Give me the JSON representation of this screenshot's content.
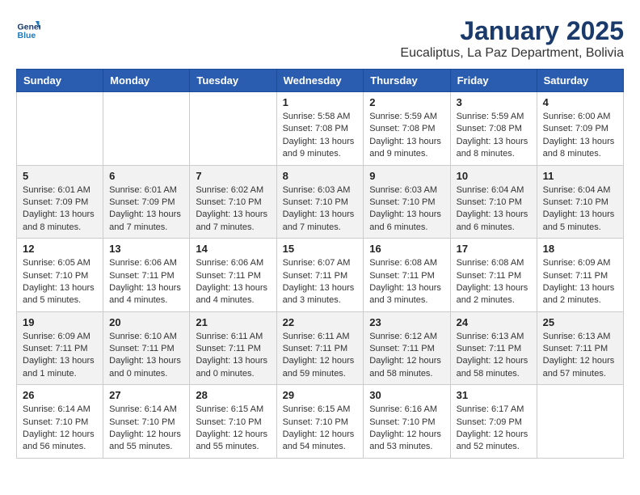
{
  "header": {
    "logo_general": "General",
    "logo_blue": "Blue",
    "month_title": "January 2025",
    "subtitle": "Eucaliptus, La Paz Department, Bolivia"
  },
  "days_of_week": [
    "Sunday",
    "Monday",
    "Tuesday",
    "Wednesday",
    "Thursday",
    "Friday",
    "Saturday"
  ],
  "weeks": [
    [
      {
        "day": "",
        "sunrise": "",
        "sunset": "",
        "daylight": ""
      },
      {
        "day": "",
        "sunrise": "",
        "sunset": "",
        "daylight": ""
      },
      {
        "day": "",
        "sunrise": "",
        "sunset": "",
        "daylight": ""
      },
      {
        "day": "1",
        "sunrise": "Sunrise: 5:58 AM",
        "sunset": "Sunset: 7:08 PM",
        "daylight": "Daylight: 13 hours and 9 minutes."
      },
      {
        "day": "2",
        "sunrise": "Sunrise: 5:59 AM",
        "sunset": "Sunset: 7:08 PM",
        "daylight": "Daylight: 13 hours and 9 minutes."
      },
      {
        "day": "3",
        "sunrise": "Sunrise: 5:59 AM",
        "sunset": "Sunset: 7:08 PM",
        "daylight": "Daylight: 13 hours and 8 minutes."
      },
      {
        "day": "4",
        "sunrise": "Sunrise: 6:00 AM",
        "sunset": "Sunset: 7:09 PM",
        "daylight": "Daylight: 13 hours and 8 minutes."
      }
    ],
    [
      {
        "day": "5",
        "sunrise": "Sunrise: 6:01 AM",
        "sunset": "Sunset: 7:09 PM",
        "daylight": "Daylight: 13 hours and 8 minutes."
      },
      {
        "day": "6",
        "sunrise": "Sunrise: 6:01 AM",
        "sunset": "Sunset: 7:09 PM",
        "daylight": "Daylight: 13 hours and 7 minutes."
      },
      {
        "day": "7",
        "sunrise": "Sunrise: 6:02 AM",
        "sunset": "Sunset: 7:10 PM",
        "daylight": "Daylight: 13 hours and 7 minutes."
      },
      {
        "day": "8",
        "sunrise": "Sunrise: 6:03 AM",
        "sunset": "Sunset: 7:10 PM",
        "daylight": "Daylight: 13 hours and 7 minutes."
      },
      {
        "day": "9",
        "sunrise": "Sunrise: 6:03 AM",
        "sunset": "Sunset: 7:10 PM",
        "daylight": "Daylight: 13 hours and 6 minutes."
      },
      {
        "day": "10",
        "sunrise": "Sunrise: 6:04 AM",
        "sunset": "Sunset: 7:10 PM",
        "daylight": "Daylight: 13 hours and 6 minutes."
      },
      {
        "day": "11",
        "sunrise": "Sunrise: 6:04 AM",
        "sunset": "Sunset: 7:10 PM",
        "daylight": "Daylight: 13 hours and 5 minutes."
      }
    ],
    [
      {
        "day": "12",
        "sunrise": "Sunrise: 6:05 AM",
        "sunset": "Sunset: 7:10 PM",
        "daylight": "Daylight: 13 hours and 5 minutes."
      },
      {
        "day": "13",
        "sunrise": "Sunrise: 6:06 AM",
        "sunset": "Sunset: 7:11 PM",
        "daylight": "Daylight: 13 hours and 4 minutes."
      },
      {
        "day": "14",
        "sunrise": "Sunrise: 6:06 AM",
        "sunset": "Sunset: 7:11 PM",
        "daylight": "Daylight: 13 hours and 4 minutes."
      },
      {
        "day": "15",
        "sunrise": "Sunrise: 6:07 AM",
        "sunset": "Sunset: 7:11 PM",
        "daylight": "Daylight: 13 hours and 3 minutes."
      },
      {
        "day": "16",
        "sunrise": "Sunrise: 6:08 AM",
        "sunset": "Sunset: 7:11 PM",
        "daylight": "Daylight: 13 hours and 3 minutes."
      },
      {
        "day": "17",
        "sunrise": "Sunrise: 6:08 AM",
        "sunset": "Sunset: 7:11 PM",
        "daylight": "Daylight: 13 hours and 2 minutes."
      },
      {
        "day": "18",
        "sunrise": "Sunrise: 6:09 AM",
        "sunset": "Sunset: 7:11 PM",
        "daylight": "Daylight: 13 hours and 2 minutes."
      }
    ],
    [
      {
        "day": "19",
        "sunrise": "Sunrise: 6:09 AM",
        "sunset": "Sunset: 7:11 PM",
        "daylight": "Daylight: 13 hours and 1 minute."
      },
      {
        "day": "20",
        "sunrise": "Sunrise: 6:10 AM",
        "sunset": "Sunset: 7:11 PM",
        "daylight": "Daylight: 13 hours and 0 minutes."
      },
      {
        "day": "21",
        "sunrise": "Sunrise: 6:11 AM",
        "sunset": "Sunset: 7:11 PM",
        "daylight": "Daylight: 13 hours and 0 minutes."
      },
      {
        "day": "22",
        "sunrise": "Sunrise: 6:11 AM",
        "sunset": "Sunset: 7:11 PM",
        "daylight": "Daylight: 12 hours and 59 minutes."
      },
      {
        "day": "23",
        "sunrise": "Sunrise: 6:12 AM",
        "sunset": "Sunset: 7:11 PM",
        "daylight": "Daylight: 12 hours and 58 minutes."
      },
      {
        "day": "24",
        "sunrise": "Sunrise: 6:13 AM",
        "sunset": "Sunset: 7:11 PM",
        "daylight": "Daylight: 12 hours and 58 minutes."
      },
      {
        "day": "25",
        "sunrise": "Sunrise: 6:13 AM",
        "sunset": "Sunset: 7:11 PM",
        "daylight": "Daylight: 12 hours and 57 minutes."
      }
    ],
    [
      {
        "day": "26",
        "sunrise": "Sunrise: 6:14 AM",
        "sunset": "Sunset: 7:10 PM",
        "daylight": "Daylight: 12 hours and 56 minutes."
      },
      {
        "day": "27",
        "sunrise": "Sunrise: 6:14 AM",
        "sunset": "Sunset: 7:10 PM",
        "daylight": "Daylight: 12 hours and 55 minutes."
      },
      {
        "day": "28",
        "sunrise": "Sunrise: 6:15 AM",
        "sunset": "Sunset: 7:10 PM",
        "daylight": "Daylight: 12 hours and 55 minutes."
      },
      {
        "day": "29",
        "sunrise": "Sunrise: 6:15 AM",
        "sunset": "Sunset: 7:10 PM",
        "daylight": "Daylight: 12 hours and 54 minutes."
      },
      {
        "day": "30",
        "sunrise": "Sunrise: 6:16 AM",
        "sunset": "Sunset: 7:10 PM",
        "daylight": "Daylight: 12 hours and 53 minutes."
      },
      {
        "day": "31",
        "sunrise": "Sunrise: 6:17 AM",
        "sunset": "Sunset: 7:09 PM",
        "daylight": "Daylight: 12 hours and 52 minutes."
      },
      {
        "day": "",
        "sunrise": "",
        "sunset": "",
        "daylight": ""
      }
    ]
  ]
}
